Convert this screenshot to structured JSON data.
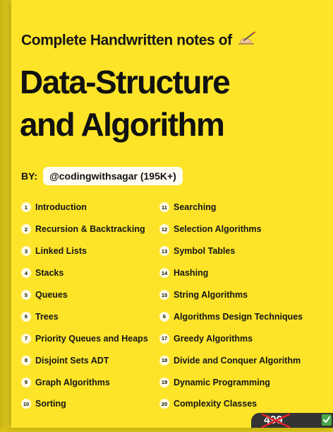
{
  "header": {
    "subtitle": "Complete Handwritten notes of",
    "title_line1": "Data-Structure",
    "title_line2": "and Algorithm"
  },
  "author": {
    "label": "BY:",
    "handle": "@codingwithsagar (195K+)"
  },
  "topics": [
    {
      "num": "1",
      "label": "Introduction"
    },
    {
      "num": "2",
      "label": "Recursion & Backtracking"
    },
    {
      "num": "3",
      "label": "Linked Lists"
    },
    {
      "num": "4",
      "label": "Stacks"
    },
    {
      "num": "5",
      "label": "Queues"
    },
    {
      "num": "6",
      "label": "Trees"
    },
    {
      "num": "7",
      "label": "Priority Queues and Heaps"
    },
    {
      "num": "8",
      "label": "Disjoint Sets ADT"
    },
    {
      "num": "9",
      "label": "Graph Algorithms"
    },
    {
      "num": "10",
      "label": "Sorting"
    },
    {
      "num": "11",
      "label": "Searching"
    },
    {
      "num": "12",
      "label": "Selection Algorithms"
    },
    {
      "num": "13",
      "label": "Symbol Tables"
    },
    {
      "num": "14",
      "label": "Hashing"
    },
    {
      "num": "15",
      "label": "String Algorithms"
    },
    {
      "num": "6",
      "label": "Algorithms Design Techniques"
    },
    {
      "num": "17",
      "label": "Greedy Algorithms"
    },
    {
      "num": "18",
      "label": "Divide and Conquer Algorithm"
    },
    {
      "num": "19",
      "label": "Dynamic Programming"
    },
    {
      "num": "20",
      "label": "Complexity Classes"
    }
  ],
  "price_sticker": {
    "crossed_price": "499"
  },
  "colors": {
    "background": "#fde428",
    "text": "#111111",
    "badge": "#fffbe3"
  },
  "icons": {
    "pen": "writing-hand-icon",
    "cross": "cross-icon",
    "check": "check-icon"
  }
}
